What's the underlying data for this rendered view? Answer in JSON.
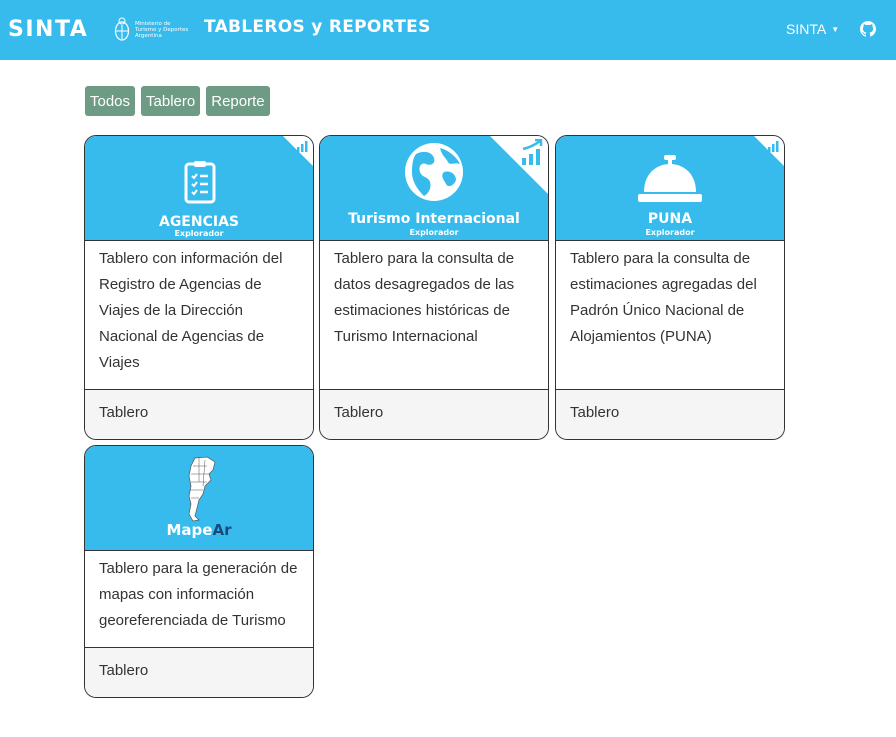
{
  "navbar": {
    "brand": "SINTA",
    "ministry": {
      "line1": "Ministerio de",
      "line2": "Turismo y Deportes",
      "line3": "Argentina"
    },
    "title": "TABLEROS y REPORTES",
    "user_label": "SINTA",
    "caret": "▼",
    "github_icon": "github-icon"
  },
  "filters": [
    {
      "label": "Todos"
    },
    {
      "label": "Tablero"
    },
    {
      "label": "Reporte"
    }
  ],
  "cards": [
    {
      "title": "AGENCIAS",
      "subtitle": "Explorador",
      "icon": "clipboard-list-icon",
      "corner_icon": "bar-chart-icon",
      "description": "Tablero con información del Registro de Agencias de Viajes de la Dirección Nacional de Agencias de Viajes",
      "footer": "Tablero"
    },
    {
      "title": "Turismo Internacional",
      "subtitle": "Explorador",
      "icon": "globe-icon",
      "corner_icon": "growth-chart-icon",
      "description": "Tablero para la consulta de datos desagregados de las estimaciones históricas de Turismo Internacional",
      "footer": "Tablero"
    },
    {
      "title": "PUNA",
      "subtitle": "Explorador",
      "icon": "service-bell-icon",
      "corner_icon": "bar-chart-icon",
      "description": "Tablero para la consulta de estimaciones agregadas del Padrón Único Nacional de Alojamientos (PUNA)",
      "footer": "Tablero"
    },
    {
      "title_part1": "Mape",
      "title_part2": "Ar",
      "icon": "argentina-map-icon",
      "description": "Tablero para la generación de mapas con información georeferenciada de Turismo",
      "footer": "Tablero"
    }
  ],
  "colors": {
    "primary": "#37bbed",
    "filter_button": "#6d9b83",
    "mapear_ar": "#1a4a7a"
  }
}
